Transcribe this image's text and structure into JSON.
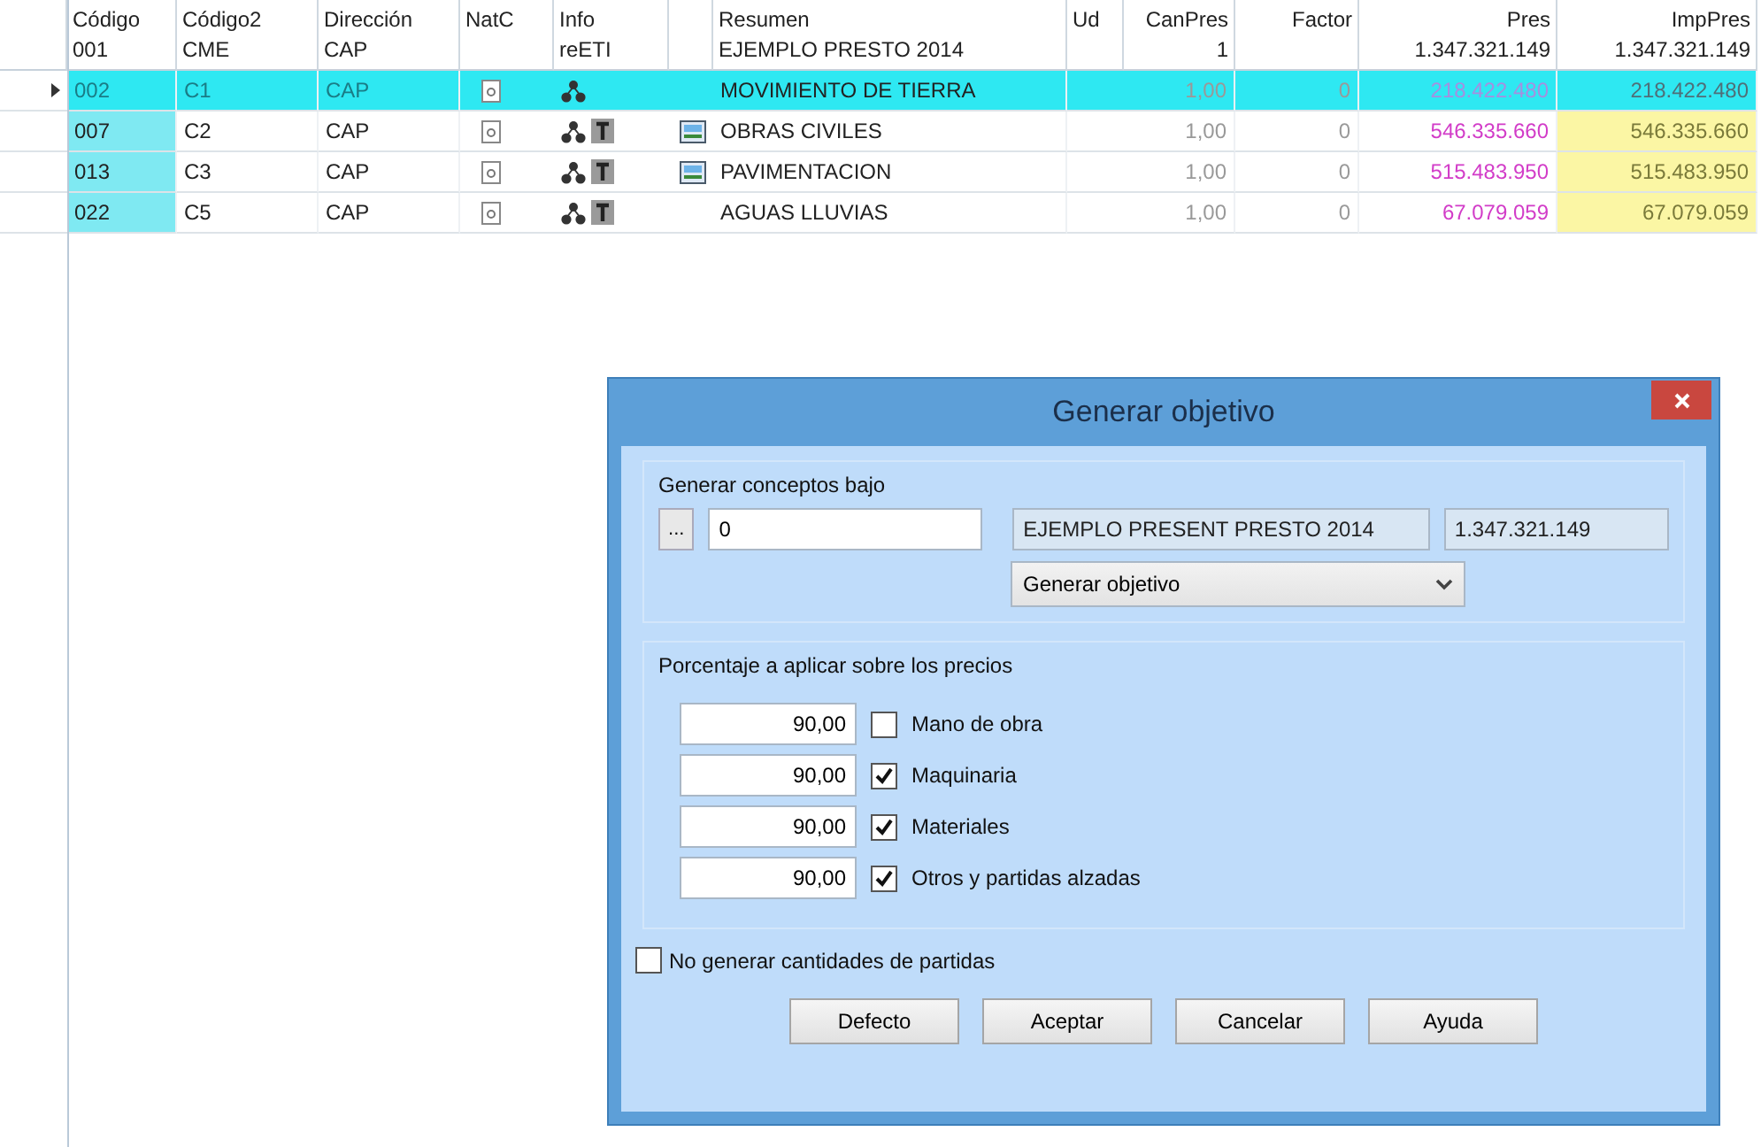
{
  "table": {
    "columns": [
      {
        "label": "Código",
        "total": "001"
      },
      {
        "label": "Código2",
        "total": "CME"
      },
      {
        "label": "Dirección",
        "total": "CAP"
      },
      {
        "label": "NatC"
      },
      {
        "label": "Info",
        "total": "reETI"
      },
      {},
      {
        "label": "Resumen",
        "total": "EJEMPLO PRESTO 2014"
      },
      {
        "label": "Ud"
      },
      {
        "label": "CanPres",
        "total": "1"
      },
      {
        "label": "Factor"
      },
      {
        "label": "Pres",
        "total": "1.347.321.149"
      },
      {
        "label": "ImpPres",
        "total": "1.347.321.149"
      }
    ],
    "rows": [
      {
        "selected": true,
        "code": "002",
        "code2": "C1",
        "direccion": "CAP",
        "has_text": false,
        "has_image": false,
        "resumen": "MOVIMIENTO DE TIERRA",
        "canpres": "1,00",
        "factor": "0",
        "pres": "218.422.480",
        "imppres": "218.422.480"
      },
      {
        "selected": false,
        "code": "007",
        "code2": "C2",
        "direccion": "CAP",
        "has_text": true,
        "has_image": true,
        "resumen": "OBRAS CIVILES",
        "canpres": "1,00",
        "factor": "0",
        "pres": "546.335.660",
        "imppres": "546.335.660"
      },
      {
        "selected": false,
        "code": "013",
        "code2": "C3",
        "direccion": "CAP",
        "has_text": true,
        "has_image": true,
        "resumen": "PAVIMENTACION",
        "canpres": "1,00",
        "factor": "0",
        "pres": "515.483.950",
        "imppres": "515.483.950"
      },
      {
        "selected": false,
        "code": "022",
        "code2": "C5",
        "direccion": "CAP",
        "has_text": true,
        "has_image": false,
        "resumen": "AGUAS LLUVIAS",
        "canpres": "1,00",
        "factor": "0",
        "pres": "67.079.059",
        "imppres": "67.079.059"
      }
    ]
  },
  "dialog": {
    "title": "Generar objetivo",
    "group1": {
      "legend": "Generar conceptos bajo",
      "browse": "...",
      "code": "0",
      "name": "EJEMPLO PRESENT PRESTO 2014",
      "amount": "1.347.321.149",
      "dropdown": "Generar objetivo"
    },
    "group2": {
      "legend": "Porcentaje a aplicar sobre los precios",
      "items": [
        {
          "value": "90,00",
          "label": "Mano de obra",
          "checked": false
        },
        {
          "value": "90,00",
          "label": "Maquinaria",
          "checked": true
        },
        {
          "value": "90,00",
          "label": "Materiales",
          "checked": true
        },
        {
          "value": "90,00",
          "label": "Otros y partidas alzadas",
          "checked": true
        }
      ]
    },
    "no_quantities": {
      "label": "No generar cantidades de partidas",
      "checked": false
    },
    "buttons": [
      "Defecto",
      "Aceptar",
      "Cancelar",
      "Ayuda"
    ]
  }
}
